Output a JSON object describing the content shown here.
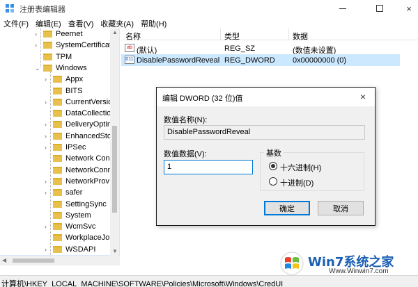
{
  "window": {
    "title": "注册表编辑器",
    "buttons": {
      "minimize": "minimize",
      "maximize": "maximize",
      "close": "×"
    }
  },
  "menu": [
    "文件(F)",
    "编辑(E)",
    "查看(V)",
    "收藏夹(A)",
    "帮助(H)"
  ],
  "tree": {
    "items": [
      {
        "label": "Peernet",
        "expandable": true
      },
      {
        "label": "SystemCertificate",
        "expandable": true
      },
      {
        "label": "TPM",
        "expandable": false
      },
      {
        "label": "Windows",
        "expandable": true,
        "expanded": true
      },
      {
        "label": "Appx",
        "expandable": true
      },
      {
        "label": "BITS",
        "expandable": false
      },
      {
        "label": "CurrentVersic",
        "expandable": true
      },
      {
        "label": "DataCollectio",
        "expandable": false
      },
      {
        "label": "DeliveryOptin",
        "expandable": true
      },
      {
        "label": "EnhancedStor",
        "expandable": true
      },
      {
        "label": "IPSec",
        "expandable": true
      },
      {
        "label": "Network Con",
        "expandable": false
      },
      {
        "label": "NetworkConn",
        "expandable": false
      },
      {
        "label": "NetworkProv",
        "expandable": true
      },
      {
        "label": "safer",
        "expandable": true
      },
      {
        "label": "SettingSync",
        "expandable": false
      },
      {
        "label": "System",
        "expandable": false
      },
      {
        "label": "WcmSvc",
        "expandable": true
      },
      {
        "label": "WorkplaceJo",
        "expandable": false
      },
      {
        "label": "WSDAPI",
        "expandable": true
      },
      {
        "label": "CredUI",
        "expandable": false,
        "selected": true
      }
    ]
  },
  "list": {
    "columns": {
      "name": "名称",
      "type": "类型",
      "data": "数据"
    },
    "rows": [
      {
        "name": "(默认)",
        "type": "REG_SZ",
        "data": "(数值未设置)",
        "icon": "string-value-icon",
        "icon_text": "ab"
      },
      {
        "name": "DisablePasswordReveal",
        "type": "REG_DWORD",
        "data": "0x00000000 (0)",
        "icon": "binary-value-icon",
        "icon_text": "011",
        "selected": true
      }
    ]
  },
  "dialog": {
    "title": "编辑 DWORD (32 位)值",
    "close": "×",
    "name_label": "数值名称(N):",
    "name_value": "DisablePasswordReveal",
    "data_label": "数值数据(V):",
    "data_value": "1",
    "base_label": "基数",
    "base_options": [
      {
        "label": "十六进制(H)",
        "checked": true
      },
      {
        "label": "十进制(D)",
        "checked": false
      }
    ],
    "ok_label": "确定",
    "cancel_label": "取消"
  },
  "status": {
    "path": "计算机\\HKEY_LOCAL_MACHINE\\SOFTWARE\\Policies\\Microsoft\\Windows\\CredUI"
  },
  "watermark": {
    "brand": "Win7系统之家",
    "url": "Www.Winwin7.com"
  },
  "colors": {
    "selection": "#cce8ff",
    "folder": "#e8c04d",
    "focus": "#0078d7"
  }
}
